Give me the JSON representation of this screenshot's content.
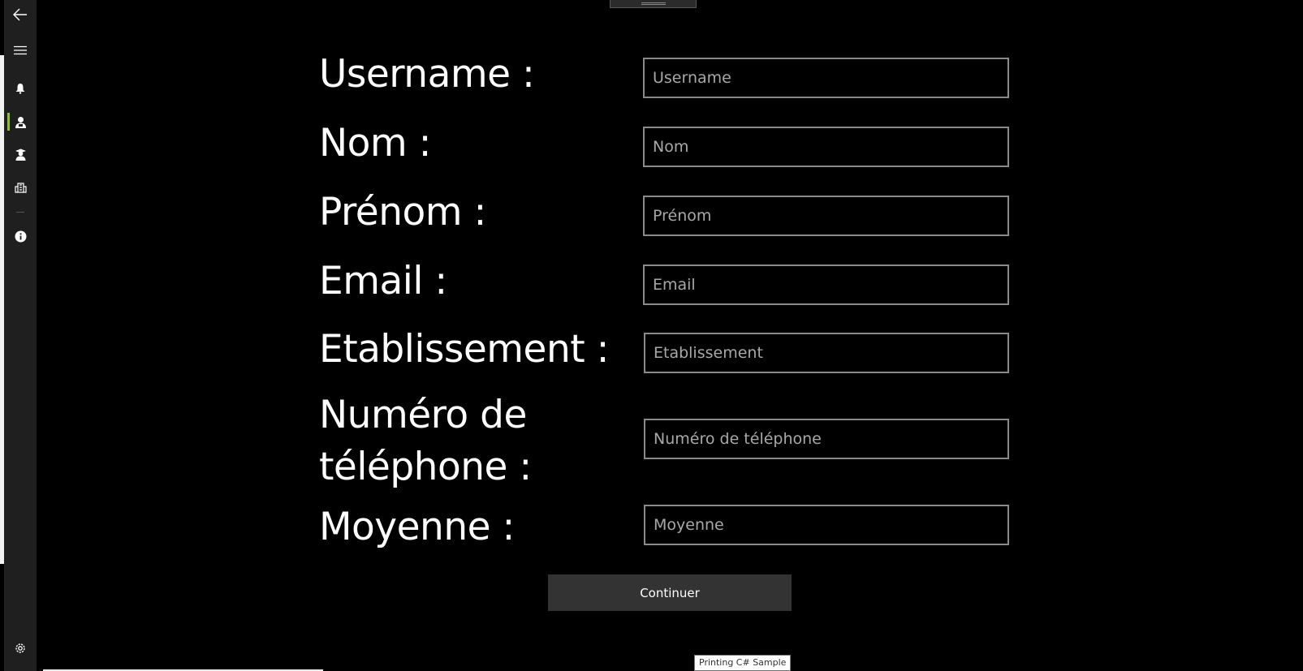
{
  "nav": {
    "back": "back-arrow",
    "menu": "hamburger-menu",
    "items": [
      {
        "icon": "bell-icon",
        "selected": false
      },
      {
        "icon": "user-icon",
        "selected": true
      },
      {
        "icon": "graduate-icon",
        "selected": false
      },
      {
        "icon": "building-icon",
        "selected": false
      },
      {
        "icon": "info-icon",
        "selected": false
      }
    ],
    "settings": "gear-icon",
    "accent_color": "#8fc31f"
  },
  "form": {
    "username": {
      "label": "Username :",
      "placeholder": "Username"
    },
    "nom": {
      "label": "Nom :",
      "placeholder": "Nom"
    },
    "prenom": {
      "label": "Prénom :",
      "placeholder": "Prénom"
    },
    "email": {
      "label": "Email :",
      "placeholder": "Email"
    },
    "etablissement": {
      "label": "Etablissement :",
      "placeholder": "Etablissement"
    },
    "telephone": {
      "label": "Numéro de téléphone :",
      "placeholder": "Numéro de téléphone"
    },
    "moyenne": {
      "label": "Moyenne :",
      "placeholder": "Moyenne"
    }
  },
  "continue_label": "Continuer",
  "tooltip": "Printing C# Sample"
}
